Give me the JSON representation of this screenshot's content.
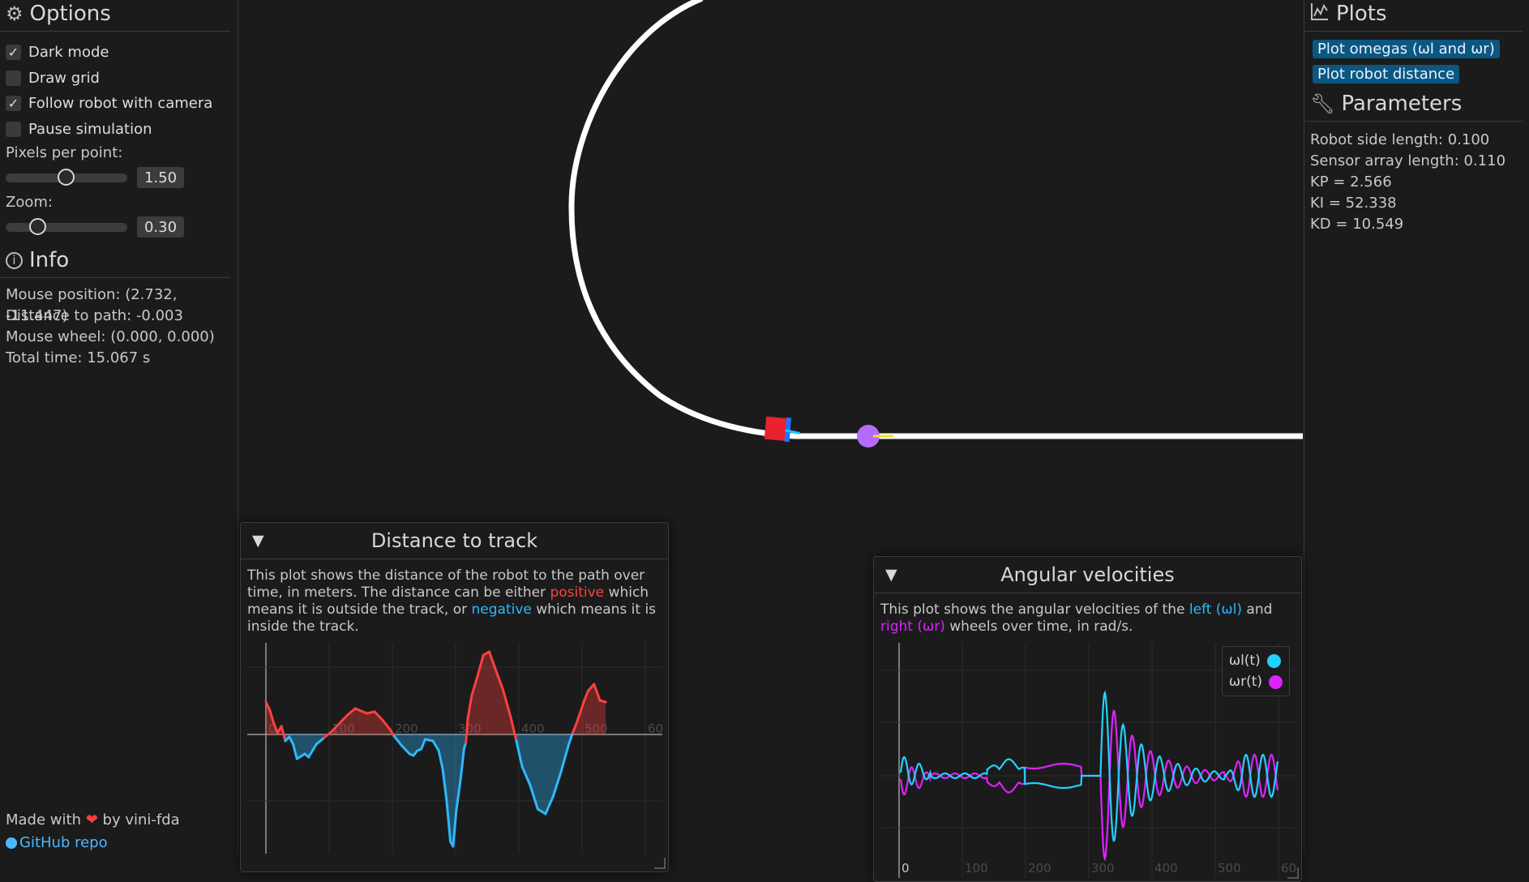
{
  "options": {
    "title": "Options",
    "checkboxes": [
      {
        "label": "Dark mode",
        "checked": true
      },
      {
        "label": "Draw grid",
        "checked": false
      },
      {
        "label": "Follow robot with camera",
        "checked": true
      },
      {
        "label": "Pause simulation",
        "checked": false
      }
    ],
    "pixels_per_point": {
      "label": "Pixels per point:",
      "value": "1.50"
    },
    "zoom": {
      "label": "Zoom:",
      "value": "0.30"
    }
  },
  "info": {
    "title": "Info",
    "mouse_position": "Mouse position: (2.732, -11.447)",
    "distance_to_path": "Distance to path: -0.003",
    "mouse_wheel": "Mouse wheel: (0.000, 0.000)",
    "total_time": "Total time: 15.067 s"
  },
  "footer": {
    "made_with": "Made with",
    "by": "by vini-fda",
    "github": "GitHub repo"
  },
  "plots": {
    "title": "Plots",
    "buttons": [
      "Plot omegas (ωl and ωr)",
      "Plot robot distance"
    ]
  },
  "parameters": {
    "title": "Parameters",
    "lines": [
      "Robot side length: 0.100",
      "Sensor array length: 0.110",
      "KP = 2.566",
      "KI = 52.338",
      "KD = 10.549"
    ]
  },
  "distance_window": {
    "title": "Distance to track",
    "desc": {
      "p1": "This plot shows the distance of the robot to the path over time, in meters. The distance can be either ",
      "positive": "positive",
      "p2": " which means it is outside the track, or ",
      "negative": "negative",
      "p3": " which means it is inside the track."
    },
    "x_ticks": [
      "0",
      "100",
      "200",
      "300",
      "400",
      "500",
      "60"
    ]
  },
  "angular_window": {
    "title": "Angular velocities",
    "desc": {
      "p1": "This plot shows the angular velocities of the ",
      "left": "left (ωl)",
      "p2": " and ",
      "right": "right (ωr)",
      "p3": " wheels over time, in rad/s."
    },
    "legend": [
      "ωl(t)",
      "ωr(t)"
    ],
    "x_ticks": [
      "0",
      "100",
      "200",
      "300",
      "400",
      "500",
      "60"
    ]
  },
  "colors": {
    "positive": "#ff4040",
    "negative": "#2fb8ff",
    "omega_l": "#22d0ff",
    "omega_r": "#dd22ff",
    "button_bg": "#0b5782"
  }
}
